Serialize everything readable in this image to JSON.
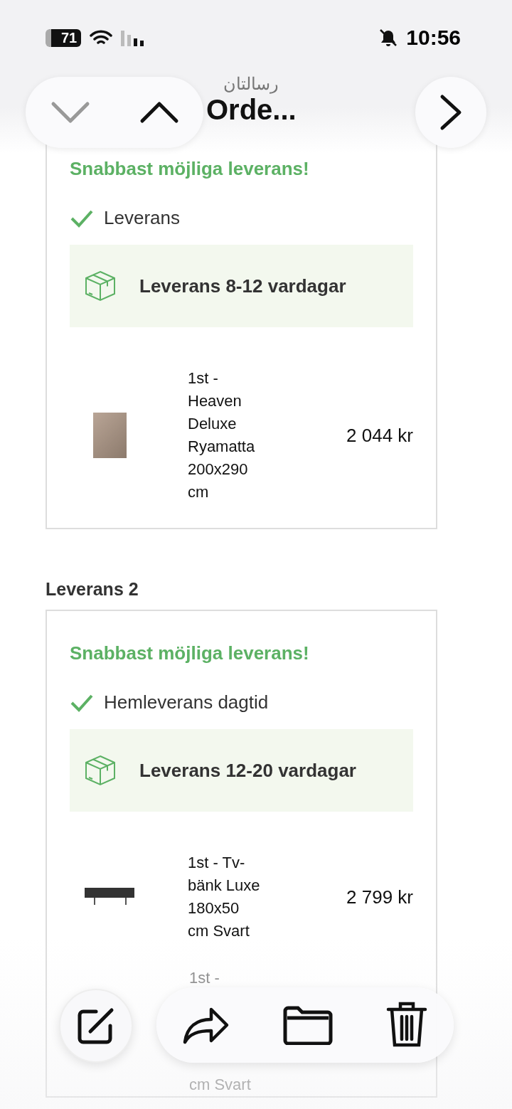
{
  "status_bar": {
    "battery": "71",
    "time": "10:56"
  },
  "header": {
    "subtitle": "رسالتان",
    "title": "Orde..."
  },
  "deliveries": [
    {
      "promo": "Snabbast möjliga leverans!",
      "method": "Leverans",
      "estimate": "Leverans 8-12 vardagar",
      "items": [
        {
          "lines": [
            "1st - Heaven Deluxe Ryamatta 200x290 cm"
          ],
          "price": "2 044 kr",
          "kind": "rug"
        }
      ]
    },
    {
      "heading": "Leverans 2",
      "promo": "Snabbast möjliga leverans!",
      "method": "Hemleverans dagtid",
      "estimate": "Leverans 12-20 vardagar",
      "items": [
        {
          "lines": [
            "1st - Tv-bänk Luxe 180x50 cm Svart"
          ],
          "price": "2 799 kr",
          "kind": "tv-bench"
        },
        {
          "lines": [
            "1st -",
            "cm Svart"
          ],
          "kind": "hidden"
        }
      ]
    }
  ]
}
